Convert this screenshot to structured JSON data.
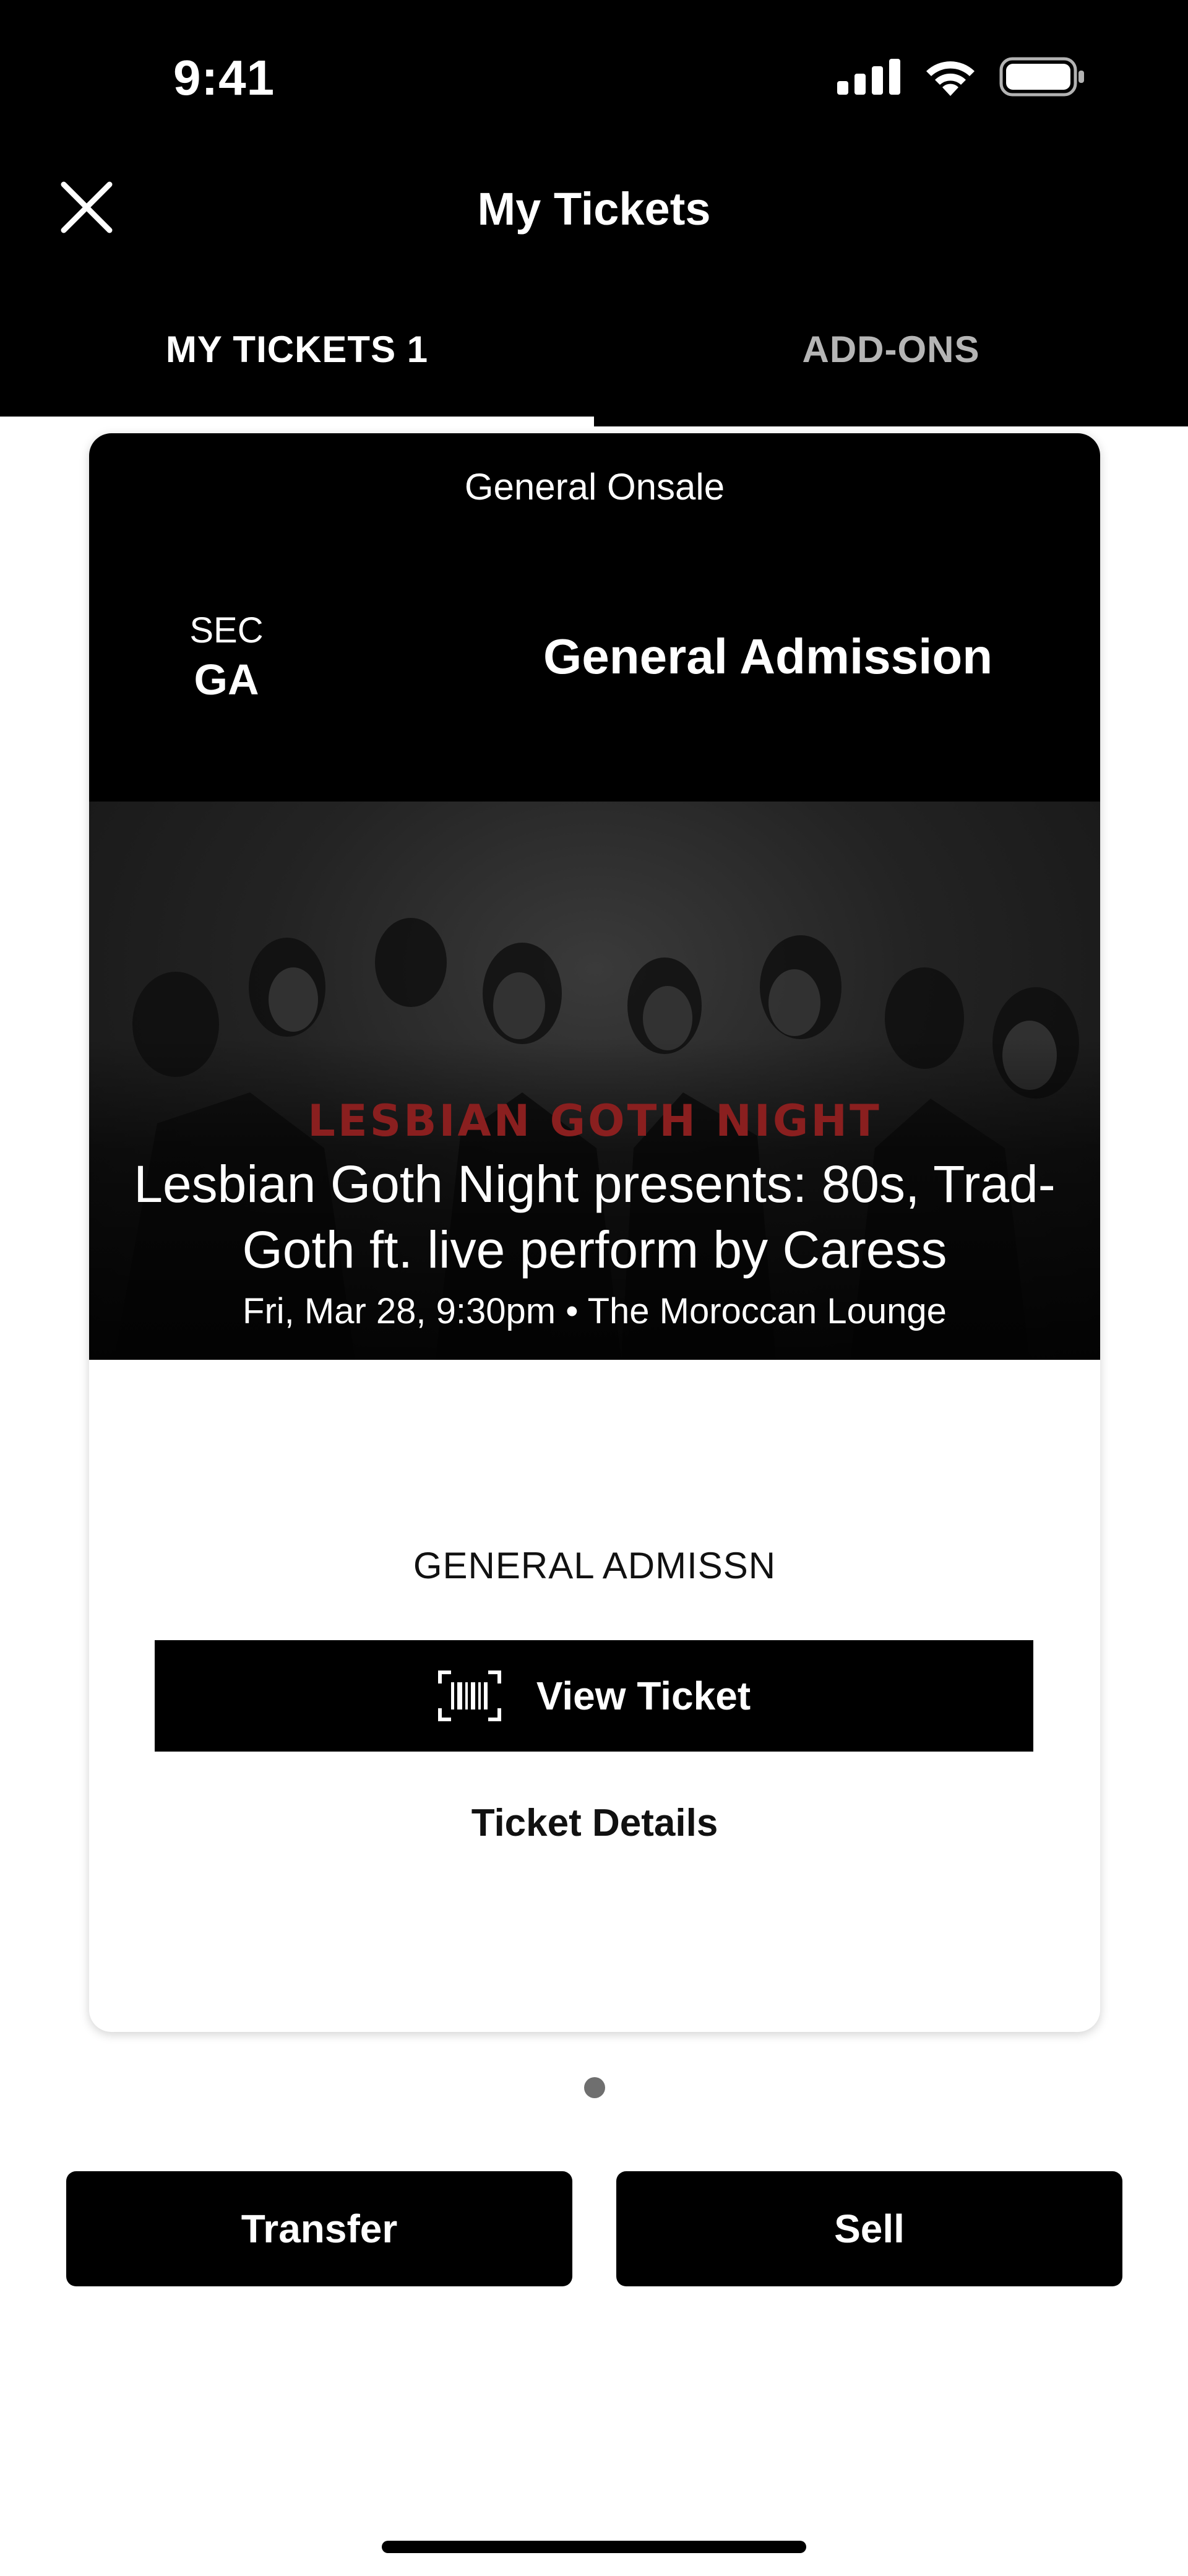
{
  "status_bar": {
    "time": "9:41",
    "icons": [
      "signal-icon",
      "wifi-icon",
      "battery-icon"
    ]
  },
  "nav": {
    "title": "My Tickets",
    "close_icon": "close-icon"
  },
  "tabs": [
    {
      "label": "MY TICKETS 1",
      "active": true
    },
    {
      "label": "ADD-ONS",
      "active": false
    }
  ],
  "ticket": {
    "onsale_label": "General Onsale",
    "sec_label": "SEC",
    "sec_value": "GA",
    "admission_title": "General Admission",
    "banner": {
      "logo_text": "LESBIAN GOTH NIGHT",
      "event_title": "Lesbian Goth Night presents: 80s, Trad-Goth ft. live perform by Caress",
      "event_meta": "Fri, Mar 28, 9:30pm • The Moroccan Lounge"
    },
    "ticket_type": "GENERAL ADMISSN",
    "view_ticket_label": "View Ticket",
    "view_ticket_icon": "barcode-icon",
    "details_label": "Ticket Details"
  },
  "pagination": {
    "current": 1,
    "total": 1
  },
  "actions": {
    "transfer_label": "Transfer",
    "sell_label": "Sell"
  },
  "colors": {
    "background": "#ffffff",
    "header": "#000000",
    "accent_logo": "#8a1f1f",
    "tab_inactive": "#b5b5b5",
    "dot": "#6f6f6f"
  }
}
